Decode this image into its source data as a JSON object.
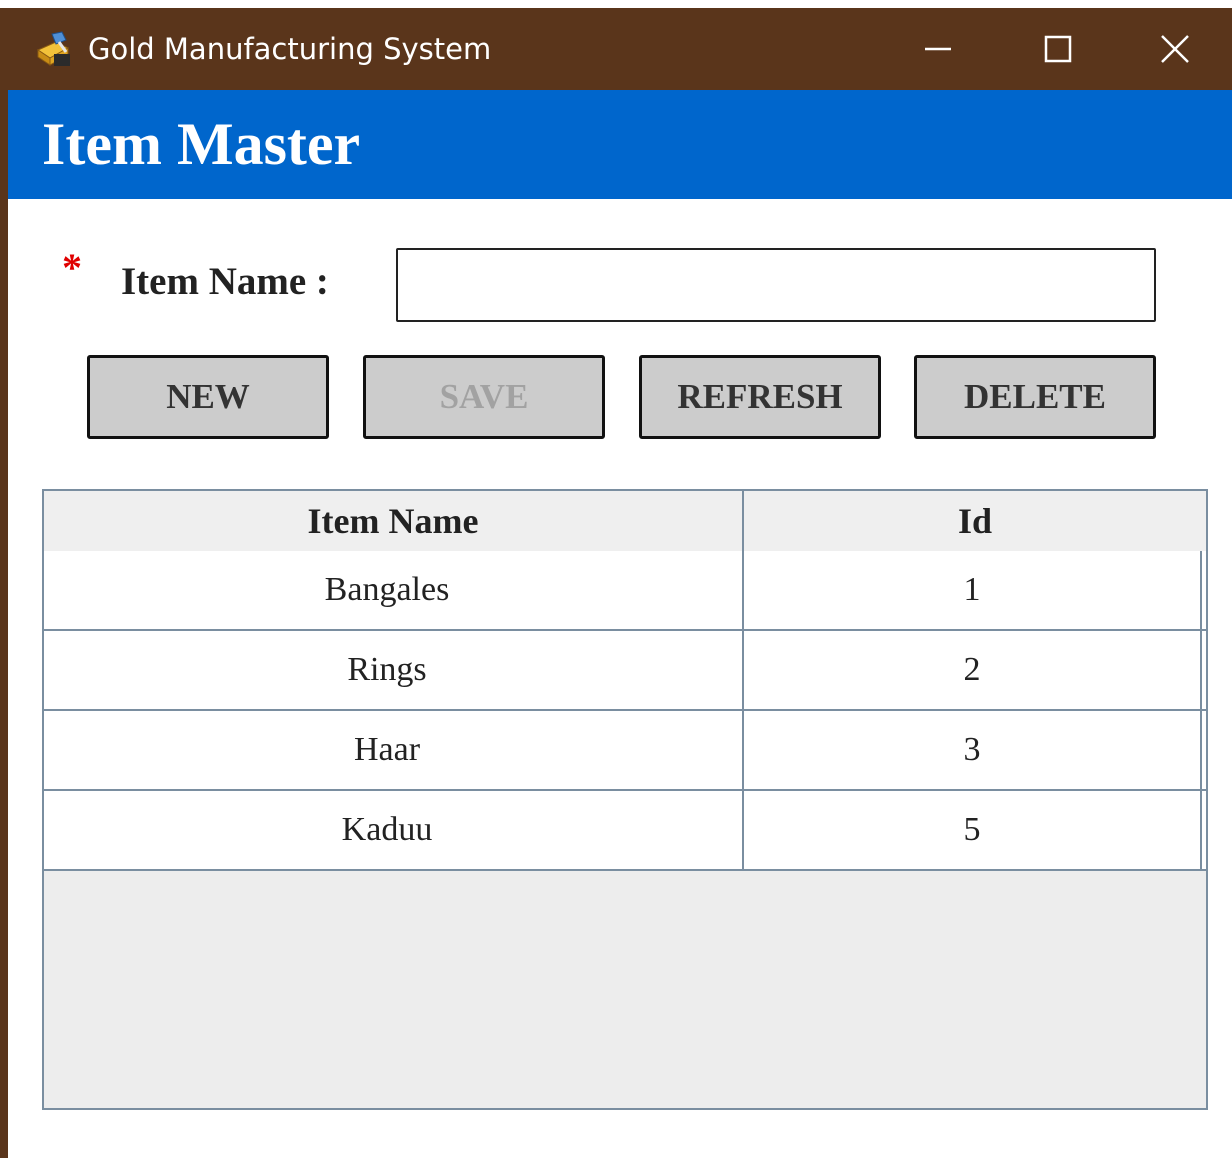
{
  "window": {
    "title": "Gold Manufacturing System",
    "app_icon": "gold-bar-edit-icon",
    "controls": {
      "minimize_icon": "minimize-icon",
      "maximize_icon": "maximize-icon",
      "close_icon": "close-icon"
    }
  },
  "header": {
    "title": "Item Master"
  },
  "form": {
    "required_marker": "*",
    "item_name_label": "Item Name :",
    "item_name_value": "",
    "item_name_placeholder": ""
  },
  "toolbar": {
    "new_label": "NEW",
    "save_label": "SAVE",
    "save_enabled": false,
    "refresh_label": "REFRESH",
    "delete_label": "DELETE"
  },
  "grid": {
    "columns": [
      "Item Name",
      "Id"
    ],
    "rows": [
      {
        "item_name": "Bangales",
        "id": "1"
      },
      {
        "item_name": "Rings",
        "id": "2"
      },
      {
        "item_name": "Haar",
        "id": "3"
      },
      {
        "item_name": "Kaduu",
        "id": "5"
      }
    ]
  },
  "colors": {
    "titlebar": "#5a351b",
    "header": "#0066cc",
    "required": "#e00000",
    "button_face": "#cccccc",
    "grid_border": "#7a8ea0",
    "grid_empty": "#ededed"
  }
}
